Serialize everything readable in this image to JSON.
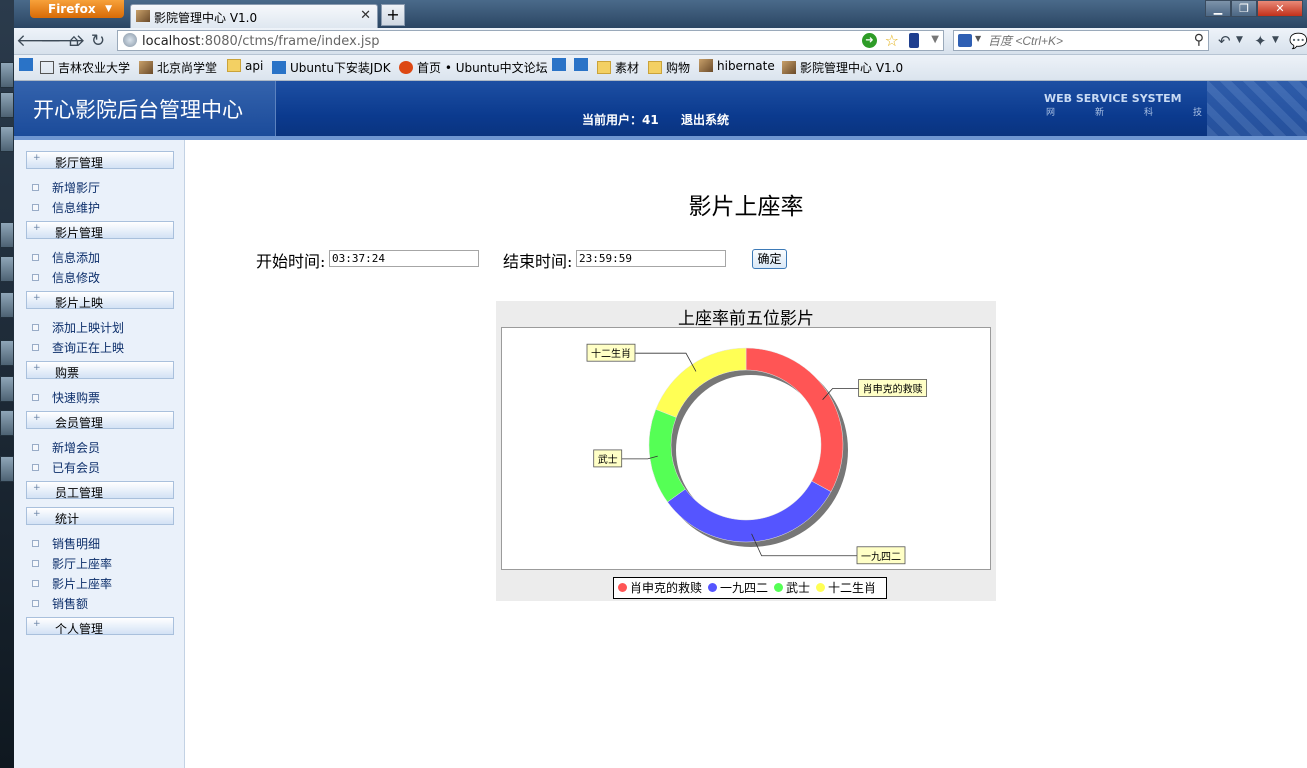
{
  "browser": {
    "app_button": "Firefox",
    "tab_title": "影院管理中心 V1.0",
    "new_tab": "+",
    "url_host": "localhost",
    "url_path": ":8080/ctms/frame/index.jsp",
    "search_placeholder": "百度 <Ctrl+K>"
  },
  "bookmarks": [
    {
      "label": "吉林农业大学",
      "icon": "box"
    },
    {
      "label": "北京尚学堂",
      "icon": "site"
    },
    {
      "label": "api",
      "icon": "folder"
    },
    {
      "label": "Ubuntu下安装JDK",
      "icon": "blue"
    },
    {
      "label": "首页 • Ubuntu中文论坛",
      "icon": "ub"
    },
    {
      "label": "素材",
      "icon": "folder"
    },
    {
      "label": "购物",
      "icon": "folder"
    },
    {
      "label": "hibernate",
      "icon": "site"
    },
    {
      "label": "影院管理中心 V1.0",
      "icon": "site"
    }
  ],
  "header": {
    "title": "开心影院后台管理中心",
    "user_label": "当前用户：41",
    "logout": "退出系统",
    "brand": "WEB SERVICE SYSTEM",
    "brand_sub": "网新科技"
  },
  "sidebar": {
    "sections": [
      {
        "label": "影厅管理",
        "items": [
          "新增影厅",
          "信息维护"
        ]
      },
      {
        "label": "影片管理",
        "items": [
          "信息添加",
          "信息修改"
        ]
      },
      {
        "label": "影片上映",
        "items": [
          "添加上映计划",
          "查询正在上映"
        ]
      },
      {
        "label": "购票",
        "items": [
          "快速购票"
        ]
      },
      {
        "label": "会员管理",
        "items": [
          "新增会员",
          "已有会员"
        ]
      },
      {
        "label": "员工管理",
        "items": []
      },
      {
        "label": "统计",
        "items": [
          "销售明细",
          "影厅上座率",
          "影片上座率",
          "销售额"
        ]
      },
      {
        "label": "个人管理",
        "items": []
      }
    ]
  },
  "main": {
    "title": "影片上座率",
    "start_label": "开始时间:",
    "start_value": "03:37:24",
    "end_label": "结束时间:",
    "end_value": "23:59:59",
    "confirm": "确定"
  },
  "chart_data": {
    "type": "pie",
    "style": "donut",
    "title": "上座率前五位影片",
    "slices": [
      {
        "label": "肖申克的救赎",
        "value": 33,
        "color": "#ff5555"
      },
      {
        "label": "一九四二",
        "value": 32,
        "color": "#5555ff"
      },
      {
        "label": "武士",
        "value": 16,
        "color": "#55ff55"
      },
      {
        "label": "十二生肖",
        "value": 19,
        "color": "#ffff55"
      }
    ],
    "legend": "bottom"
  }
}
